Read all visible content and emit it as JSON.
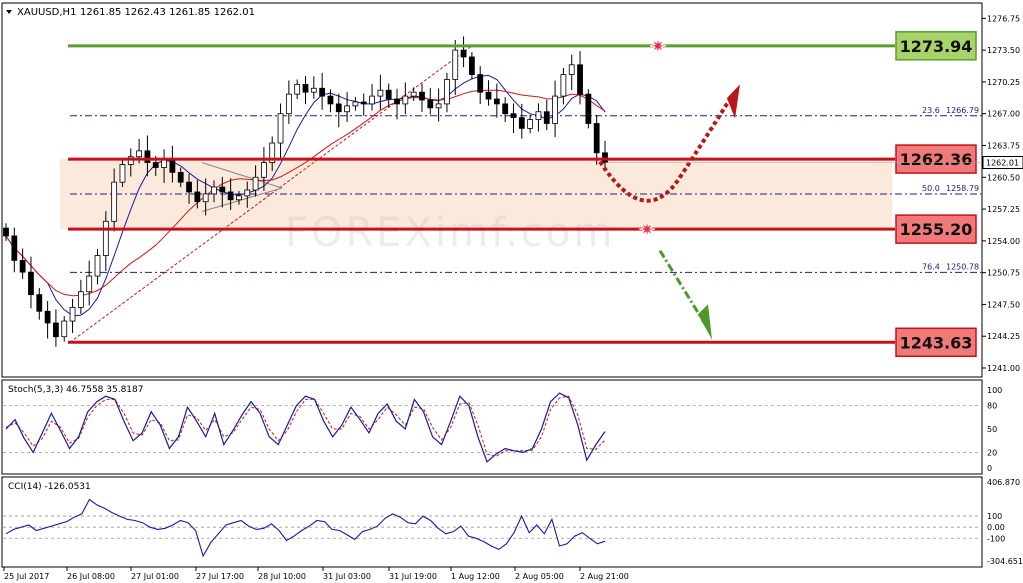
{
  "header": {
    "symbol": "XAUUSD,H1",
    "ohlc": "1261.85 1262.43 1261.85 1262.01"
  },
  "watermark": "FOREXimf.com",
  "colors": {
    "resistance_green": "#5a9e2e",
    "support_red": "#c8101a",
    "zone_fill": "#fbe9dc",
    "label_red_fill": "#f07a7a",
    "label_green_fill": "#a8d26a",
    "fib_blue": "#1e1e8c",
    "ma_blue": "#1a1aa0",
    "ma_red": "#d01818",
    "arrow_up": "#b81818",
    "arrow_down": "#4a9a2a"
  },
  "chart_data": [
    {
      "type": "candlestick",
      "title": "XAUUSD,H1",
      "ylim": [
        1241.0,
        1277.5
      ],
      "y_ticks": [
        "1276.75",
        "1273.50",
        "1270.25",
        "1267.00",
        "1263.75",
        "1260.50",
        "1257.25",
        "1254.00",
        "1250.75",
        "1247.50",
        "1244.25",
        "1241.00"
      ],
      "x_ticks": [
        "25 Jul 2017",
        "26 Jul 08:00",
        "27 Jul 01:00",
        "27 Jul 17:00",
        "28 Jul 10:00",
        "31 Jul 03:00",
        "31 Jul 19:00",
        "1 Aug 12:00",
        "2 Aug 05:00",
        "2 Aug 21:00"
      ],
      "current_price": "1262.01",
      "levels": [
        {
          "name": "resistance",
          "value": 1273.94,
          "label": "1273.94"
        },
        {
          "name": "support-1",
          "value": 1262.36,
          "label": "1262.36"
        },
        {
          "name": "support-2",
          "value": 1255.2,
          "label": "1255.20"
        },
        {
          "name": "support-3",
          "value": 1243.63,
          "label": "1243.63"
        }
      ],
      "fibonacci": [
        {
          "ratio": "23.6",
          "value": 1266.79,
          "label": "1266.79"
        },
        {
          "ratio": "50.0",
          "value": 1258.79,
          "label": "1258.79"
        },
        {
          "ratio": "76.4",
          "value": 1250.78,
          "label": "1250.78"
        }
      ],
      "zone": [
        1255.2,
        1262.36
      ],
      "closes": [
        1254.5,
        1252.0,
        1250.8,
        1248.5,
        1246.8,
        1245.6,
        1244.2,
        1245.8,
        1247.2,
        1248.8,
        1250.4,
        1252.5,
        1256.0,
        1260.0,
        1261.8,
        1262.6,
        1263.2,
        1262.0,
        1261.5,
        1262.3,
        1261.0,
        1260.0,
        1259.0,
        1258.0,
        1258.8,
        1259.5,
        1259.0,
        1258.2,
        1258.6,
        1259.2,
        1260.5,
        1262.0,
        1264.0,
        1267.0,
        1269.0,
        1270.0,
        1269.2,
        1269.6,
        1268.8,
        1268.0,
        1267.2,
        1267.8,
        1268.2,
        1268.0,
        1268.8,
        1269.4,
        1268.5,
        1268.0,
        1268.8,
        1269.2,
        1268.4,
        1267.6,
        1268.0,
        1270.5,
        1273.5,
        1272.8,
        1271.0,
        1269.2,
        1268.5,
        1268.0,
        1267.0,
        1266.6,
        1265.5,
        1266.4,
        1267.2,
        1266.0,
        1268.8,
        1271.0,
        1272.0,
        1269.0,
        1266.0,
        1263.0,
        1262.01
      ]
    },
    {
      "type": "line",
      "title": "Stoch(5,3,3) 46.7558 35.8187",
      "ylim": [
        0,
        100
      ],
      "y_ticks": [
        "100",
        "80",
        "50",
        "20",
        "0"
      ],
      "values": [
        50,
        62,
        38,
        20,
        45,
        70,
        48,
        25,
        40,
        72,
        85,
        92,
        88,
        60,
        35,
        45,
        72,
        55,
        25,
        40,
        78,
        60,
        40,
        70,
        30,
        48,
        68,
        85,
        70,
        40,
        30,
        55,
        80,
        92,
        88,
        60,
        40,
        55,
        78,
        62,
        45,
        70,
        82,
        60,
        50,
        88,
        72,
        40,
        30,
        60,
        92,
        80,
        40,
        8,
        18,
        25,
        22,
        20,
        25,
        50,
        85,
        96,
        90,
        55,
        10,
        30,
        46.7558
      ],
      "signal": [
        52,
        58,
        45,
        28,
        38,
        60,
        52,
        32,
        38,
        65,
        80,
        88,
        88,
        70,
        45,
        42,
        62,
        58,
        35,
        36,
        68,
        65,
        48,
        62,
        40,
        45,
        62,
        78,
        75,
        50,
        35,
        48,
        72,
        88,
        88,
        70,
        50,
        50,
        70,
        66,
        50,
        62,
        78,
        68,
        55,
        78,
        76,
        52,
        36,
        52,
        82,
        84,
        55,
        18,
        15,
        22,
        22,
        22,
        23,
        40,
        75,
        90,
        92,
        68,
        25,
        24,
        35.8187
      ]
    },
    {
      "type": "line",
      "title": "CCI(14) -126.0531",
      "ylim": [
        -304.651,
        406.87
      ],
      "y_ticks": [
        "406.870",
        "100",
        "0.00",
        "-100",
        "-304.651"
      ],
      "values": [
        -60,
        -20,
        0,
        20,
        -30,
        -10,
        10,
        30,
        50,
        90,
        120,
        250,
        200,
        170,
        130,
        100,
        70,
        60,
        40,
        0,
        -20,
        -10,
        20,
        60,
        40,
        -30,
        -260,
        -140,
        -60,
        20,
        40,
        60,
        10,
        -20,
        -10,
        30,
        -30,
        -120,
        -80,
        -30,
        10,
        60,
        50,
        -20,
        -30,
        -70,
        -110,
        -40,
        -20,
        10,
        80,
        120,
        90,
        40,
        30,
        100,
        60,
        -10,
        -60,
        -40,
        10,
        -80,
        -100,
        -130,
        -170,
        -200,
        -150,
        -50,
        100,
        -50,
        20,
        -60,
        70,
        -170,
        -150,
        -80,
        -50,
        -100,
        -150,
        -126.0531
      ]
    }
  ]
}
